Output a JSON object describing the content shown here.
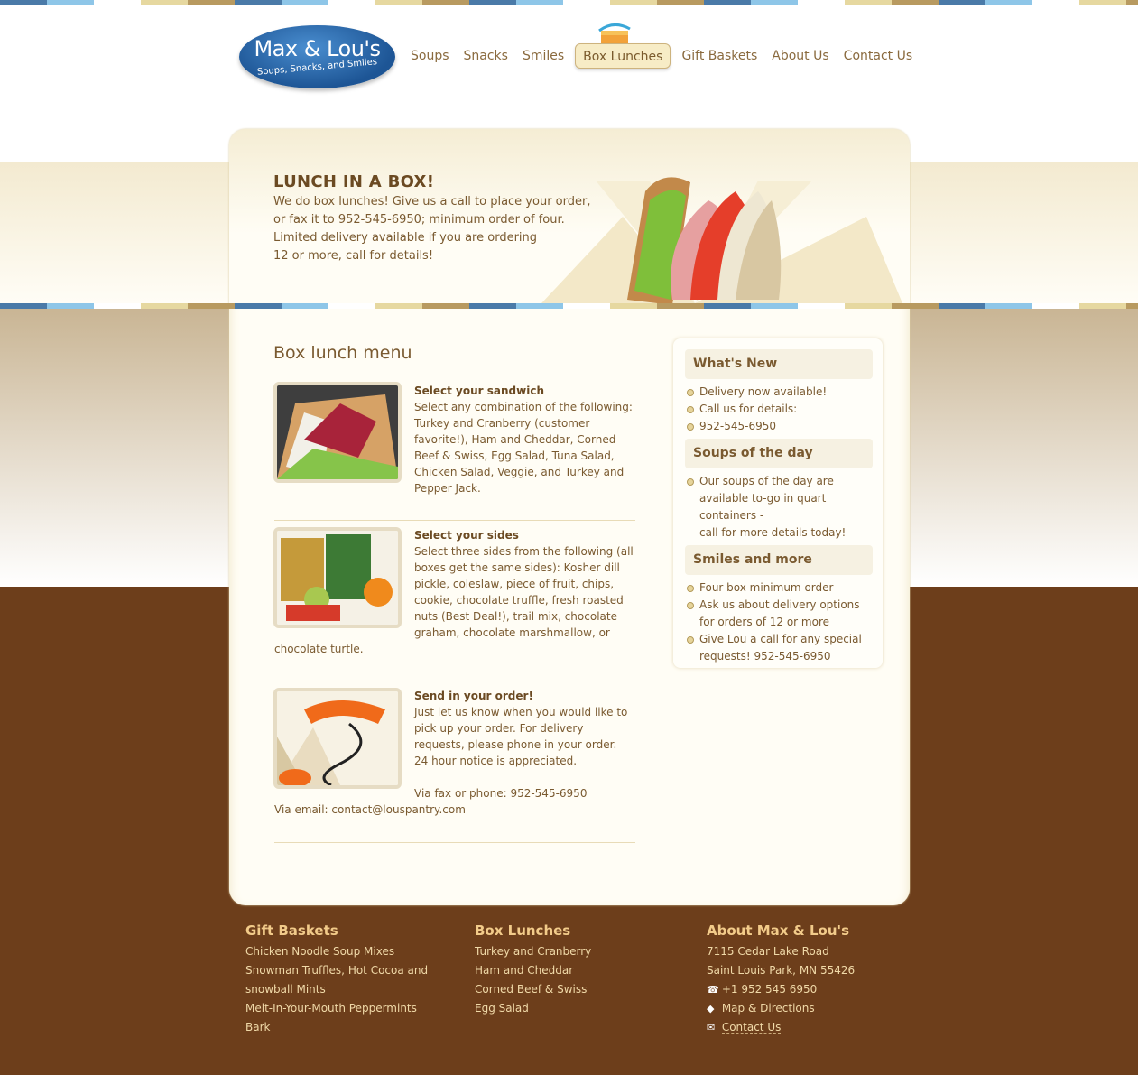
{
  "logo": {
    "name": "Max & Lou's",
    "tagline": "Soups, Snacks, and Smiles"
  },
  "nav": [
    {
      "label": "Soups"
    },
    {
      "label": "Snacks"
    },
    {
      "label": "Smiles"
    },
    {
      "label": "Box Lunches",
      "active": true
    },
    {
      "label": "Gift Baskets"
    },
    {
      "label": "About Us"
    },
    {
      "label": "Contact Us"
    }
  ],
  "hero": {
    "title": "LUNCH IN A BOX!",
    "line1_pre": "We do ",
    "line1_link": "box lunches",
    "line1_post": "! Give us a call to place your order,",
    "line2": "or fax it to 952-545-6950; minimum order of four.",
    "line3": "Limited delivery available if you are ordering",
    "line4": "12 or more, call for details!"
  },
  "menu": {
    "title": "Box lunch menu",
    "items": [
      {
        "heading": "Select your sandwich",
        "lines": [
          "Select any combination of the following:",
          "Turkey and Cranberry (customer",
          "favorite!), Ham and Cheddar, Corned",
          "Beef & Swiss, Egg Salad, Tuna Salad,",
          "Chicken Salad, Veggie, and Turkey and",
          "Pepper Jack."
        ]
      },
      {
        "heading": "Select your sides",
        "lines": [
          "Select three sides from the following (all",
          "boxes get the same sides): Kosher dill",
          "pickle, coleslaw, piece of fruit, chips,",
          "cookie, chocolate truffle, fresh roasted",
          "nuts (Best Deal!), trail mix, chocolate",
          "graham, chocolate marshmallow, or"
        ],
        "tail": "chocolate turtle."
      },
      {
        "heading": "Send in your order!",
        "lines": [
          "Just let us know when you would like to",
          "pick up your order.  For delivery",
          "requests, please phone in your order.",
          "24 hour notice is appreciated."
        ],
        "extra": "Via fax or phone: 952-545-6950",
        "tail": "Via email: contact@louspantry.com"
      }
    ]
  },
  "sidebar": {
    "sections": [
      {
        "title": "What's New",
        "items": [
          "Delivery now available!",
          "Call us for details:",
          "952-545-6950"
        ],
        "bullets": [
          true,
          true,
          true
        ]
      },
      {
        "title": "Soups of the day",
        "items": [
          "Our soups of the day are",
          "available to-go in quart",
          "containers -",
          "call for more details today!"
        ]
      },
      {
        "title": "Smiles and more",
        "items": [
          "Four box minimum order",
          "Ask us about delivery options",
          "for orders of 12 or more",
          "Give Lou a call for any special",
          "requests!  952-545-6950"
        ]
      }
    ]
  },
  "footer": {
    "gift": {
      "title": "Gift Baskets",
      "links": [
        "Chicken Noodle Soup Mixes",
        "Snowman Truffles, Hot Cocoa and",
        "snowball Mints",
        "Melt-In-Your-Mouth Peppermints",
        "Bark"
      ]
    },
    "lunch": {
      "title": "Box Lunches",
      "links": [
        "Turkey and Cranberry",
        "Ham and Cheddar",
        "Corned Beef & Swiss",
        "Egg Salad"
      ]
    },
    "about": {
      "title": "About Max & Lou's",
      "address1": "7115 Cedar Lake Road",
      "address2": "Saint Louis Park, MN 55426",
      "phone": "+1 952 545 6950",
      "map": "Map & Directions",
      "contact": "Contact Us"
    }
  },
  "colors": {
    "brown": "#6d3e1b",
    "cream": "#fffdf5",
    "accent": "#f2cb8a",
    "logo_blue": "#1d5595"
  }
}
